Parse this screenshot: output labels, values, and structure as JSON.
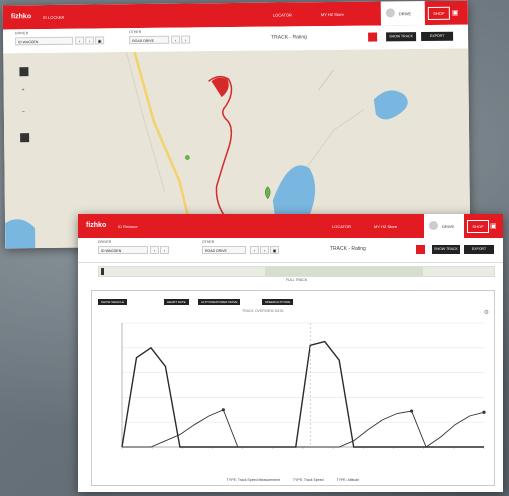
{
  "header": {
    "logo": "fizhko",
    "crumb_a": "ID LOCKER",
    "crumb_b": "ID Reissue",
    "nav_a": "LOCATOR",
    "nav_b": "MY HZ Store",
    "user": "DRIVE",
    "shop": "SHOP"
  },
  "filters": {
    "from_label": "DRIVER",
    "from_value": "ID WAGGEN",
    "to_label": "OTHER",
    "to_value": "ROAD DRIVE",
    "title": "TRACK - Rating",
    "show_label": "SHOW TRACK",
    "export_label": "EXPORT",
    "prev": "‹",
    "next": "›"
  },
  "map": {
    "zoom_in": "+",
    "zoom_out": "−"
  },
  "timeline": {
    "legend": "FULL TRACK"
  },
  "chart": {
    "btn_main": "SHOW VEHICLE",
    "btn_a": "HEART RATE",
    "btn_b": "ALTITUDE/POWER DRIVE",
    "btn_c": "SPEED/ALTITUDE",
    "subtitle": "TRACK OVERVIEW DATA",
    "legend": [
      "TYPE: Track Speed Measurement",
      "TYPE: Track Speed",
      "TYPE: Altitude"
    ]
  },
  "chart_data": {
    "type": "line",
    "title": "",
    "ylabel": "",
    "xlabel": "",
    "ylim": [
      0,
      100
    ],
    "x": [
      0,
      4,
      8,
      12,
      16,
      20,
      24,
      28,
      32,
      36,
      40,
      44,
      48,
      52,
      56,
      60,
      64,
      68,
      72,
      76,
      80,
      84,
      88,
      92,
      96,
      100
    ],
    "series": [
      {
        "name": "TYPE: Track Speed Measurement",
        "values": [
          0,
          72,
          80,
          65,
          0,
          0,
          0,
          0,
          0,
          0,
          0,
          0,
          0,
          82,
          85,
          70,
          0,
          0,
          0,
          0,
          0,
          0,
          0,
          0,
          0,
          0
        ]
      },
      {
        "name": "TYPE: Altitude",
        "values": [
          0,
          0,
          0,
          5,
          10,
          18,
          25,
          30,
          0,
          0,
          0,
          0,
          0,
          0,
          0,
          0,
          5,
          14,
          22,
          27,
          29,
          0,
          8,
          18,
          25,
          28
        ]
      }
    ]
  },
  "colors": {
    "accent": "#e21b23",
    "lake": "#7ab7e0",
    "route": "#d42a2a"
  }
}
